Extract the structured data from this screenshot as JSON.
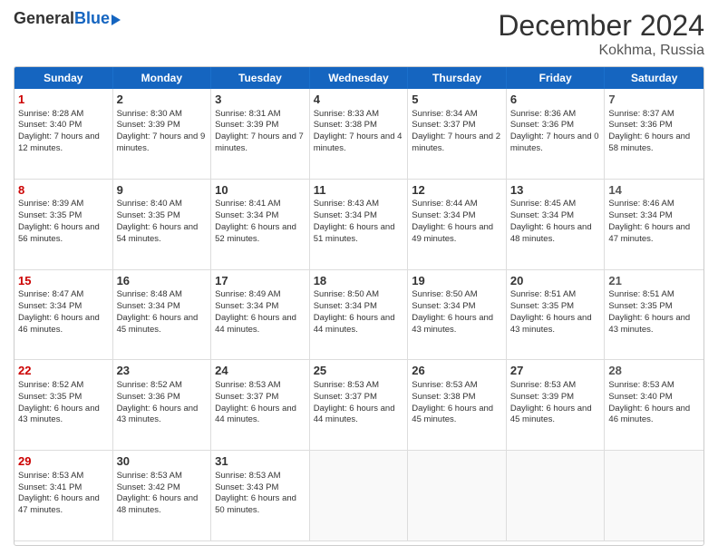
{
  "logo": {
    "general": "General",
    "blue": "Blue"
  },
  "header": {
    "title": "December 2024",
    "location": "Kokhma, Russia"
  },
  "days_of_week": [
    "Sunday",
    "Monday",
    "Tuesday",
    "Wednesday",
    "Thursday",
    "Friday",
    "Saturday"
  ],
  "weeks": [
    [
      {
        "day": "1",
        "type": "sunday",
        "sunrise": "Sunrise: 8:28 AM",
        "sunset": "Sunset: 3:40 PM",
        "daylight": "Daylight: 7 hours and 12 minutes."
      },
      {
        "day": "2",
        "type": "weekday",
        "sunrise": "Sunrise: 8:30 AM",
        "sunset": "Sunset: 3:39 PM",
        "daylight": "Daylight: 7 hours and 9 minutes."
      },
      {
        "day": "3",
        "type": "weekday",
        "sunrise": "Sunrise: 8:31 AM",
        "sunset": "Sunset: 3:39 PM",
        "daylight": "Daylight: 7 hours and 7 minutes."
      },
      {
        "day": "4",
        "type": "weekday",
        "sunrise": "Sunrise: 8:33 AM",
        "sunset": "Sunset: 3:38 PM",
        "daylight": "Daylight: 7 hours and 4 minutes."
      },
      {
        "day": "5",
        "type": "weekday",
        "sunrise": "Sunrise: 8:34 AM",
        "sunset": "Sunset: 3:37 PM",
        "daylight": "Daylight: 7 hours and 2 minutes."
      },
      {
        "day": "6",
        "type": "weekday",
        "sunrise": "Sunrise: 8:36 AM",
        "sunset": "Sunset: 3:36 PM",
        "daylight": "Daylight: 7 hours and 0 minutes."
      },
      {
        "day": "7",
        "type": "saturday",
        "sunrise": "Sunrise: 8:37 AM",
        "sunset": "Sunset: 3:36 PM",
        "daylight": "Daylight: 6 hours and 58 minutes."
      }
    ],
    [
      {
        "day": "8",
        "type": "sunday",
        "sunrise": "Sunrise: 8:39 AM",
        "sunset": "Sunset: 3:35 PM",
        "daylight": "Daylight: 6 hours and 56 minutes."
      },
      {
        "day": "9",
        "type": "weekday",
        "sunrise": "Sunrise: 8:40 AM",
        "sunset": "Sunset: 3:35 PM",
        "daylight": "Daylight: 6 hours and 54 minutes."
      },
      {
        "day": "10",
        "type": "weekday",
        "sunrise": "Sunrise: 8:41 AM",
        "sunset": "Sunset: 3:34 PM",
        "daylight": "Daylight: 6 hours and 52 minutes."
      },
      {
        "day": "11",
        "type": "weekday",
        "sunrise": "Sunrise: 8:43 AM",
        "sunset": "Sunset: 3:34 PM",
        "daylight": "Daylight: 6 hours and 51 minutes."
      },
      {
        "day": "12",
        "type": "weekday",
        "sunrise": "Sunrise: 8:44 AM",
        "sunset": "Sunset: 3:34 PM",
        "daylight": "Daylight: 6 hours and 49 minutes."
      },
      {
        "day": "13",
        "type": "weekday",
        "sunrise": "Sunrise: 8:45 AM",
        "sunset": "Sunset: 3:34 PM",
        "daylight": "Daylight: 6 hours and 48 minutes."
      },
      {
        "day": "14",
        "type": "saturday",
        "sunrise": "Sunrise: 8:46 AM",
        "sunset": "Sunset: 3:34 PM",
        "daylight": "Daylight: 6 hours and 47 minutes."
      }
    ],
    [
      {
        "day": "15",
        "type": "sunday",
        "sunrise": "Sunrise: 8:47 AM",
        "sunset": "Sunset: 3:34 PM",
        "daylight": "Daylight: 6 hours and 46 minutes."
      },
      {
        "day": "16",
        "type": "weekday",
        "sunrise": "Sunrise: 8:48 AM",
        "sunset": "Sunset: 3:34 PM",
        "daylight": "Daylight: 6 hours and 45 minutes."
      },
      {
        "day": "17",
        "type": "weekday",
        "sunrise": "Sunrise: 8:49 AM",
        "sunset": "Sunset: 3:34 PM",
        "daylight": "Daylight: 6 hours and 44 minutes."
      },
      {
        "day": "18",
        "type": "weekday",
        "sunrise": "Sunrise: 8:50 AM",
        "sunset": "Sunset: 3:34 PM",
        "daylight": "Daylight: 6 hours and 44 minutes."
      },
      {
        "day": "19",
        "type": "weekday",
        "sunrise": "Sunrise: 8:50 AM",
        "sunset": "Sunset: 3:34 PM",
        "daylight": "Daylight: 6 hours and 43 minutes."
      },
      {
        "day": "20",
        "type": "weekday",
        "sunrise": "Sunrise: 8:51 AM",
        "sunset": "Sunset: 3:35 PM",
        "daylight": "Daylight: 6 hours and 43 minutes."
      },
      {
        "day": "21",
        "type": "saturday",
        "sunrise": "Sunrise: 8:51 AM",
        "sunset": "Sunset: 3:35 PM",
        "daylight": "Daylight: 6 hours and 43 minutes."
      }
    ],
    [
      {
        "day": "22",
        "type": "sunday",
        "sunrise": "Sunrise: 8:52 AM",
        "sunset": "Sunset: 3:35 PM",
        "daylight": "Daylight: 6 hours and 43 minutes."
      },
      {
        "day": "23",
        "type": "weekday",
        "sunrise": "Sunrise: 8:52 AM",
        "sunset": "Sunset: 3:36 PM",
        "daylight": "Daylight: 6 hours and 43 minutes."
      },
      {
        "day": "24",
        "type": "weekday",
        "sunrise": "Sunrise: 8:53 AM",
        "sunset": "Sunset: 3:37 PM",
        "daylight": "Daylight: 6 hours and 44 minutes."
      },
      {
        "day": "25",
        "type": "weekday",
        "sunrise": "Sunrise: 8:53 AM",
        "sunset": "Sunset: 3:37 PM",
        "daylight": "Daylight: 6 hours and 44 minutes."
      },
      {
        "day": "26",
        "type": "weekday",
        "sunrise": "Sunrise: 8:53 AM",
        "sunset": "Sunset: 3:38 PM",
        "daylight": "Daylight: 6 hours and 45 minutes."
      },
      {
        "day": "27",
        "type": "weekday",
        "sunrise": "Sunrise: 8:53 AM",
        "sunset": "Sunset: 3:39 PM",
        "daylight": "Daylight: 6 hours and 45 minutes."
      },
      {
        "day": "28",
        "type": "saturday",
        "sunrise": "Sunrise: 8:53 AM",
        "sunset": "Sunset: 3:40 PM",
        "daylight": "Daylight: 6 hours and 46 minutes."
      }
    ],
    [
      {
        "day": "29",
        "type": "sunday",
        "sunrise": "Sunrise: 8:53 AM",
        "sunset": "Sunset: 3:41 PM",
        "daylight": "Daylight: 6 hours and 47 minutes."
      },
      {
        "day": "30",
        "type": "weekday",
        "sunrise": "Sunrise: 8:53 AM",
        "sunset": "Sunset: 3:42 PM",
        "daylight": "Daylight: 6 hours and 48 minutes."
      },
      {
        "day": "31",
        "type": "weekday",
        "sunrise": "Sunrise: 8:53 AM",
        "sunset": "Sunset: 3:43 PM",
        "daylight": "Daylight: 6 hours and 50 minutes."
      },
      null,
      null,
      null,
      null
    ]
  ]
}
